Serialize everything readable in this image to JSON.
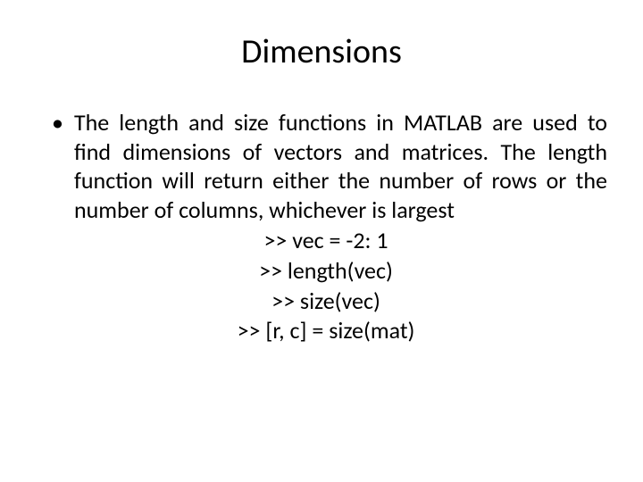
{
  "title": "Dimensions",
  "bullet": {
    "marker": "•",
    "text": "The length and  size  functions  in  MATLAB  are  used  to  find  dimensions  of vectors and matrices.  The  length  function   will  return  either the number of rows or the number of columns,  whichever is largest"
  },
  "code": {
    "line1": ">>  vec =  -2: 1",
    "line2": ">>  length(vec)",
    "line3": ">>  size(vec)",
    "line4": ">>  [r, c] =  size(mat)"
  }
}
